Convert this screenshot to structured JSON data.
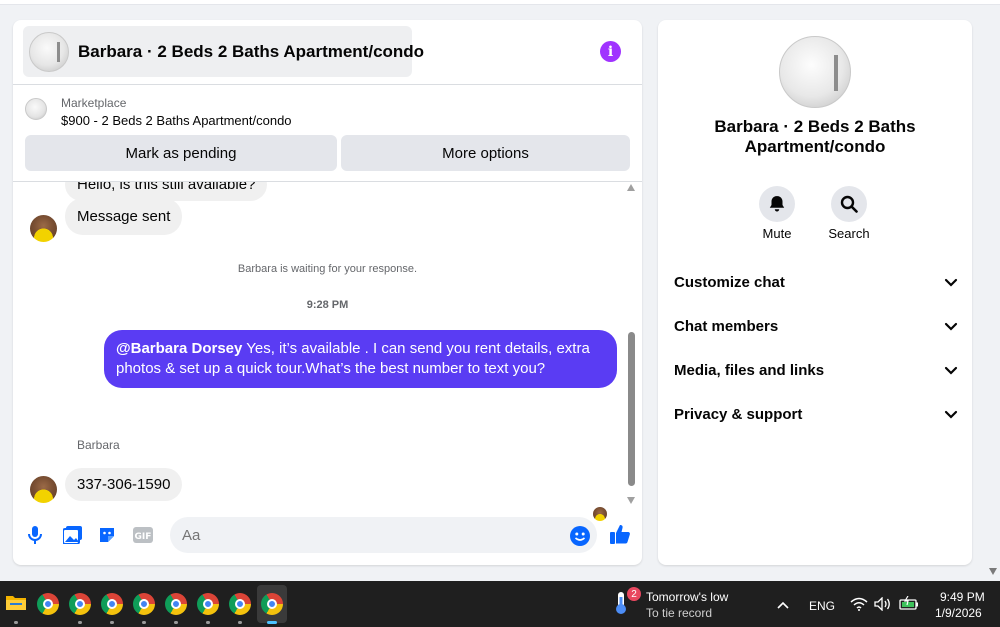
{
  "chat": {
    "title": "Barbara · 2 Beds 2 Baths Apartment/condo",
    "listing": {
      "source": "Marketplace",
      "price_title": "$900 - 2 Beds 2 Baths Apartment/condo"
    },
    "buttons": {
      "pending": "Mark as pending",
      "more": "More options"
    },
    "messages": {
      "partial": "Hello, is this still available?",
      "sent": "Message sent",
      "waiting": "Barbara is waiting for your response.",
      "time": "9:28 PM",
      "reply_mention": "@Barbara Dorsey",
      "reply_text": " Yes, it’s available .  I can send you rent details, extra photos & set up a quick tour.What’s the best number to text you?",
      "sender": "Barbara",
      "phone": "337-306-1590"
    },
    "composer_placeholder": "Aa"
  },
  "side": {
    "name": "Barbara · 2 Beds 2 Baths Apartment/condo",
    "actions": {
      "mute": "Mute",
      "search": "Search"
    },
    "menu": [
      "Customize chat",
      "Chat members",
      "Media, files and links",
      "Privacy & support"
    ]
  },
  "taskbar": {
    "weather_title": "Tomorrow's low",
    "weather_sub": "To tie record",
    "badge": "2",
    "lang": "ENG",
    "time": "9:49 PM",
    "date": "1/9/2026"
  },
  "colors": {
    "accent": "#5a3cf3",
    "info": "#a033ff",
    "icon_blue": "#0866ff"
  }
}
